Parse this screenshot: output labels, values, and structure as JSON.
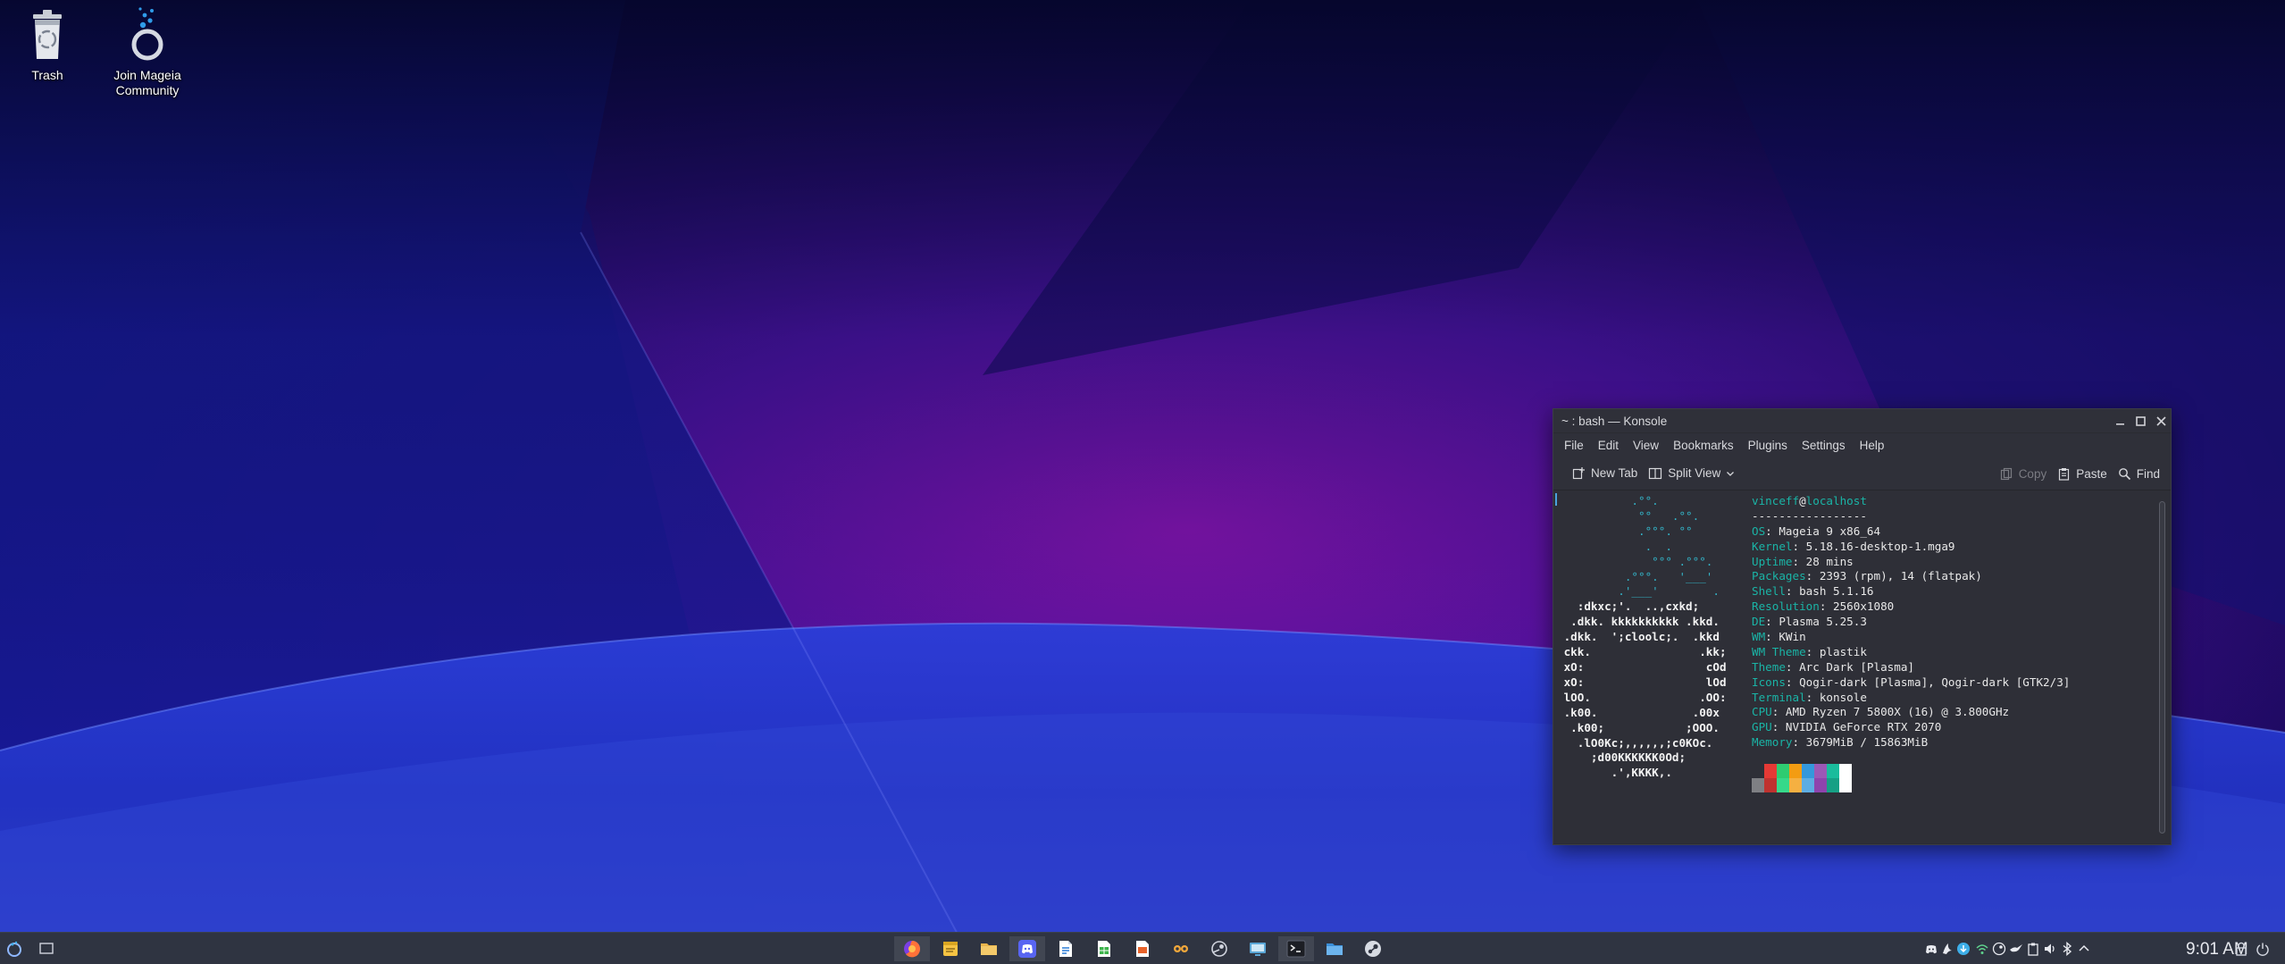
{
  "desktop": {
    "icons": [
      {
        "label": "Trash",
        "icon": "trash-icon"
      },
      {
        "label": "Join Mageia",
        "label2": "Community",
        "icon": "mageia-community-icon"
      }
    ]
  },
  "konsole": {
    "title": "~ : bash — Konsole",
    "menu": [
      "File",
      "Edit",
      "View",
      "Bookmarks",
      "Plugins",
      "Settings",
      "Help"
    ],
    "toolbar": {
      "new_tab": "New Tab",
      "split_view": "Split View",
      "copy": "Copy",
      "paste": "Paste",
      "find": "Find"
    },
    "logo_lines": [
      "           .°°.",
      "            °°   .°°.",
      "            .°°°. °°",
      "             .  .",
      "              °°° .°°°.",
      "          .°°°.   '___'",
      "         .'___'        .",
      "   :dkxc;'.  ..,cxkd;",
      "  .dkk. kkkkkkkkkk .kkd.",
      " .dkk.  ';cloolc;.  .kkd",
      " ckk.                .kk;",
      " xO:                  cOd",
      " xO:                  lOd",
      " lOO.                .OO:",
      " .k00.              .00x",
      "  .k00;            ;OOO.",
      "   .lO0Kc;,,,,,,;c0KOc.",
      "     ;d00KKKKKK0Od;",
      "        .',KKKK,."
    ],
    "user": "vinceff",
    "at": "@",
    "host": "localhost",
    "separator": "-----------------",
    "info": [
      {
        "key": "OS",
        "value": "Mageia 9 x86_64"
      },
      {
        "key": "Kernel",
        "value": "5.18.16-desktop-1.mga9"
      },
      {
        "key": "Uptime",
        "value": "28 mins"
      },
      {
        "key": "Packages",
        "value": "2393 (rpm), 14 (flatpak)"
      },
      {
        "key": "Shell",
        "value": "bash 5.1.16"
      },
      {
        "key": "Resolution",
        "value": "2560x1080"
      },
      {
        "key": "DE",
        "value": "Plasma 5.25.3"
      },
      {
        "key": "WM",
        "value": "KWin"
      },
      {
        "key": "WM Theme",
        "value": "plastik"
      },
      {
        "key": "Theme",
        "value": "Arc Dark [Plasma]"
      },
      {
        "key": "Icons",
        "value": "Qogir-dark [Plasma], Qogir-dark [GTK2/3]"
      },
      {
        "key": "Terminal",
        "value": "konsole"
      },
      {
        "key": "CPU",
        "value": "AMD Ryzen 7 5800X (16) @ 3.800GHz"
      },
      {
        "key": "GPU",
        "value": "NVIDIA GeForce RTX 2070"
      },
      {
        "key": "Memory",
        "value": "3679MiB / 15863MiB"
      }
    ],
    "palette": [
      {
        "top": "#2e2f37",
        "bottom": "#7f8084"
      },
      {
        "top": "#e53935",
        "bottom": "#c0322f"
      },
      {
        "top": "#2ecc71",
        "bottom": "#36d98a"
      },
      {
        "top": "#f39c12",
        "bottom": "#f5b041"
      },
      {
        "top": "#3498db",
        "bottom": "#5dade2"
      },
      {
        "top": "#9b59b6",
        "bottom": "#8e44ad"
      },
      {
        "top": "#1abc9c",
        "bottom": "#16a085"
      },
      {
        "top": "#ffffff",
        "bottom": "#ffffff"
      }
    ]
  },
  "taskbar": {
    "clock": "9:01 AM",
    "apps": [
      "firefox-icon",
      "notes-icon",
      "file-manager-icon",
      "discord-icon",
      "writer-icon",
      "calc-icon",
      "impress-icon",
      "lutris-icon",
      "steam-alt-icon",
      "display-manager-icon",
      "terminal-icon",
      "dolphin-icon",
      "steam-icon"
    ],
    "tray": [
      "discord-tray-icon",
      "inkscape-tray-icon",
      "update-icon",
      "network-icon",
      "steam-tray-icon",
      "swallow-icon",
      "clipboard-icon",
      "volume-icon",
      "bluetooth-icon",
      "tray-expand-icon"
    ]
  },
  "colors": {
    "accent": "#3daee9",
    "terminal_bg": "#2e2f37",
    "terminal_key": "#1ab4a6"
  }
}
